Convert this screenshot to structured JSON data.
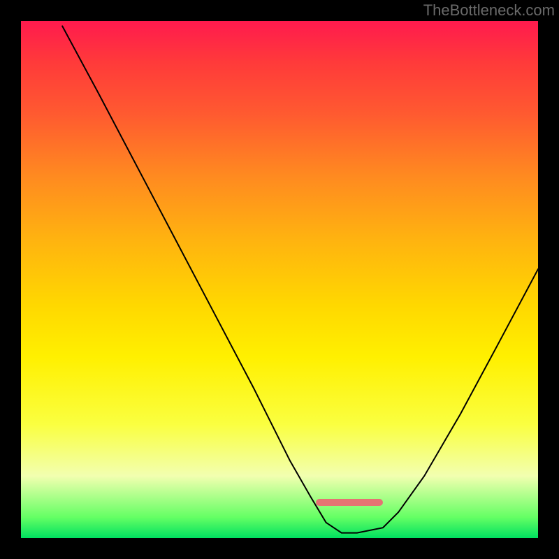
{
  "watermark": "TheBottleneck.com",
  "chart_data": {
    "type": "line",
    "title": "",
    "xlabel": "",
    "ylabel": "",
    "xlim": [
      0,
      100
    ],
    "ylim": [
      0,
      100
    ],
    "series": [
      {
        "name": "curve",
        "x": [
          8,
          15,
          25,
          35,
          45,
          52,
          56,
          59,
          62,
          65,
          70,
          73,
          78,
          85,
          92,
          100
        ],
        "values": [
          99,
          86,
          67,
          48,
          29,
          15,
          8,
          3,
          1,
          1,
          2,
          5,
          12,
          24,
          37,
          52
        ]
      }
    ],
    "valley_marker": {
      "x_start": 57,
      "x_end": 70,
      "y": 6,
      "color": "#e57373"
    },
    "colors": {
      "curve": "#000000",
      "gradient_top": "#ff1a4e",
      "gradient_bottom": "#00e060",
      "marker": "#e57373",
      "frame": "#000000"
    }
  }
}
